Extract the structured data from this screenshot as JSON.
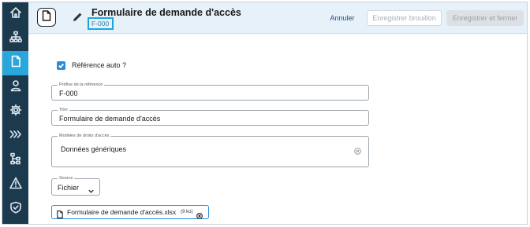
{
  "header": {
    "title": "Formulaire de demande d'accès",
    "reference": "F-000",
    "cancel_label": "Annuler",
    "save_draft_label": "Enregistrer brouillon",
    "save_close_label": "Enregistrer et fermer"
  },
  "sidebar": {
    "items": [
      {
        "icon": "home-icon"
      },
      {
        "icon": "org-chart-icon"
      },
      {
        "icon": "document-icon",
        "active": true
      },
      {
        "icon": "user-icon"
      },
      {
        "icon": "gear-icon"
      },
      {
        "icon": "chevrons-right-icon"
      },
      {
        "icon": "hierarchy-icon"
      },
      {
        "icon": "warning-icon"
      },
      {
        "icon": "shield-check-icon"
      }
    ]
  },
  "form": {
    "auto_reference": {
      "label": "Référence auto ?",
      "checked": true
    },
    "prefix": {
      "label": "Préfixe de la référence",
      "value": "F-000"
    },
    "title": {
      "label": "Titre",
      "value": "Formulaire de demande d'accès"
    },
    "rights_models": {
      "label": "Modèles de droits d'accès",
      "value": "Données génériques"
    },
    "source": {
      "label": "Source",
      "value": "Fichier"
    },
    "file": {
      "name": "Formulaire de demande d'accès.xlsx",
      "size": "(9 ko)"
    }
  },
  "colors": {
    "sidebar": "#1c3a4e",
    "accent": "#29a7dc",
    "header_bg": "#e6f1fa",
    "checkbox": "#2b8ed4"
  }
}
